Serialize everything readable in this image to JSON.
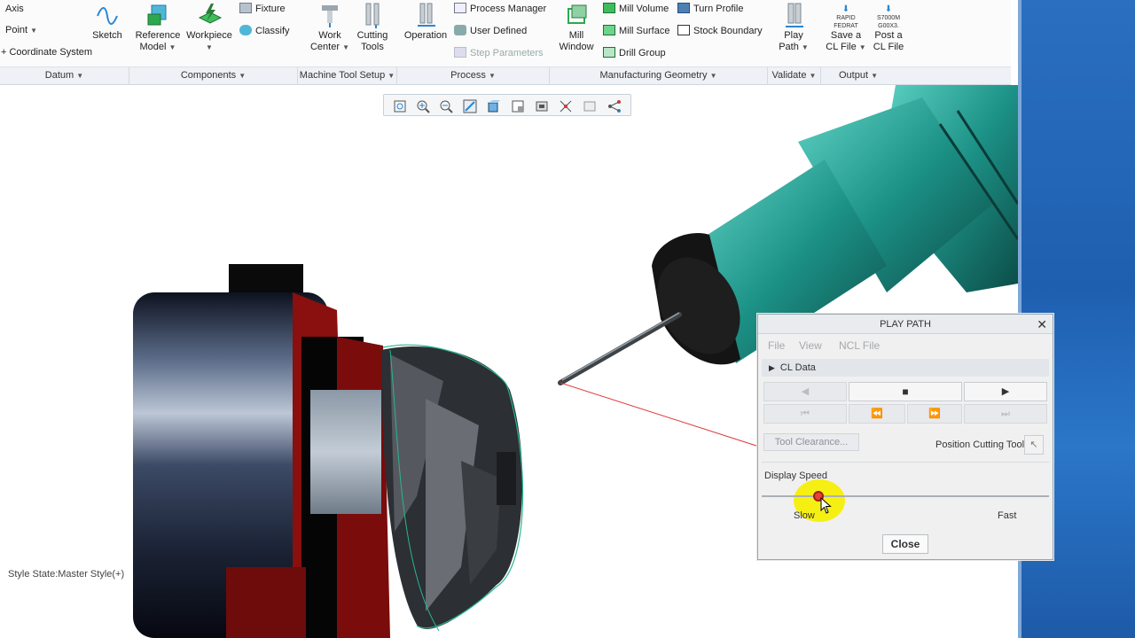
{
  "ribbon": {
    "datum": {
      "axis": "Axis",
      "point": "Point",
      "coord": "Coordinate System",
      "sketch": "Sketch"
    },
    "components": {
      "ref_model": [
        "Reference",
        "Model"
      ],
      "workpiece": "Workpiece",
      "fixture": "Fixture",
      "classify": "Classify"
    },
    "machine": {
      "work_center": [
        "Work",
        "Center"
      ],
      "cutting_tools": [
        "Cutting",
        "Tools"
      ]
    },
    "process": {
      "operation": "Operation",
      "process_manager": "Process Manager",
      "user_defined": "User Defined",
      "step_params": "Step Parameters"
    },
    "mfg_geom": {
      "mill_window": [
        "Mill",
        "Window"
      ],
      "mill_volume": "Mill Volume",
      "mill_surface": "Mill Surface",
      "drill_group": "Drill Group",
      "turn_profile": "Turn Profile",
      "stock_boundary": "Stock Boundary"
    },
    "validate": {
      "play_path": [
        "Play",
        "Path"
      ]
    },
    "output": {
      "save_cl": [
        "Save a",
        "CL File"
      ],
      "post_cl": [
        "Post a",
        "CL File"
      ],
      "save_icon_text": [
        "RAPID",
        "FEDRAT"
      ],
      "post_icon_text": [
        "S7000M",
        "G00X3."
      ]
    }
  },
  "groups": [
    {
      "label": "Datum"
    },
    {
      "label": "Components"
    },
    {
      "label": "Machine Tool Setup"
    },
    {
      "label": "Process"
    },
    {
      "label": "Manufacturing Geometry"
    },
    {
      "label": "Validate"
    },
    {
      "label": "Output"
    }
  ],
  "view_toolbar": [
    "refit-icon",
    "zoom-in-icon",
    "zoom-out-icon",
    "repaint-icon",
    "display-style-icon",
    "saved-views-icon",
    "view-manager-icon",
    "datum-display-icon",
    "annotation-icon",
    "spin-center-icon"
  ],
  "status": {
    "style_state": "Style State:Master Style(+)"
  },
  "dialog": {
    "title": "PLAY PATH",
    "menu": [
      "File",
      "View",
      "NCL File"
    ],
    "cl_data": "CL Data",
    "tool_clearance": "Tool Clearance...",
    "position_cutting_tool": "Position Cutting Tool",
    "display_speed": "Display Speed",
    "speed_level": 0.2,
    "slow": "Slow",
    "fast": "Fast",
    "close": "Close"
  }
}
